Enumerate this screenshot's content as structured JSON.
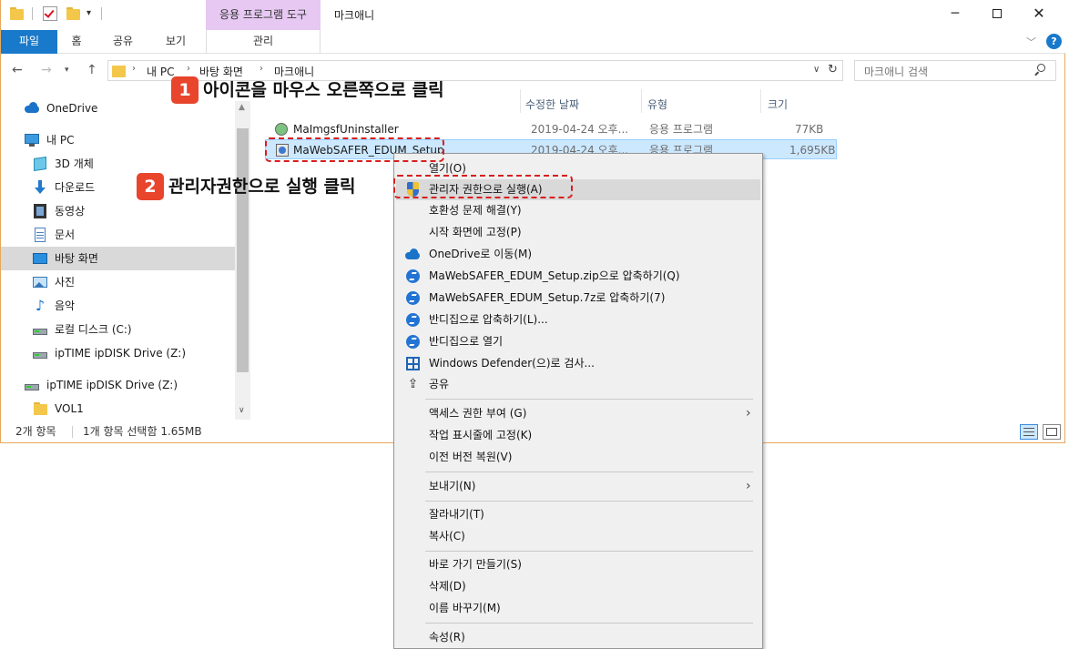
{
  "window": {
    "title": "마크애니",
    "tool_tab": "응용 프로그램 도구",
    "buttons": {
      "minimize": "─",
      "close": "✕"
    }
  },
  "ribbon": {
    "tabs": [
      "파일",
      "홈",
      "공유",
      "보기",
      "관리"
    ],
    "help": "?"
  },
  "address": {
    "crumbs": [
      "내 PC",
      "바탕 화면",
      "마크애니"
    ],
    "search_placeholder": "마크애니 검색"
  },
  "nav_pane": {
    "items": [
      {
        "label": "OneDrive",
        "icon": "onedrive-icon"
      },
      {
        "label": "내 PC",
        "icon": "pc-icon"
      },
      {
        "label": "3D 개체",
        "icon": "3d-objects-icon"
      },
      {
        "label": "다운로드",
        "icon": "download-icon"
      },
      {
        "label": "동영상",
        "icon": "video-icon"
      },
      {
        "label": "문서",
        "icon": "document-icon"
      },
      {
        "label": "바탕 화면",
        "icon": "desktop-icon",
        "selected": true
      },
      {
        "label": "사진",
        "icon": "pictures-icon"
      },
      {
        "label": "음악",
        "icon": "music-icon"
      },
      {
        "label": "로컬 디스크 (C:)",
        "icon": "local-disk-icon"
      },
      {
        "label": "ipTIME ipDISK Drive (Z:)",
        "icon": "network-drive-icon"
      },
      {
        "label": "ipTIME ipDISK Drive (Z:)",
        "icon": "network-drive-icon"
      },
      {
        "label": "VOL1",
        "icon": "folder-icon"
      }
    ]
  },
  "file_list": {
    "columns": {
      "date": "수정한 날짜",
      "type": "유형",
      "size": "크기"
    },
    "rows": [
      {
        "name": "MaImgsfUninstaller",
        "date": "2019-04-24 오후...",
        "type": "응용 프로그램",
        "size": "77KB"
      },
      {
        "name": "MaWebSAFER_EDUM_Setup",
        "date": "2019-04-24 오후...",
        "type": "응용 프로그램",
        "size": "1,695KB",
        "selected": true
      }
    ]
  },
  "status_bar": {
    "count": "2개 항목",
    "selection": "1개 항목 선택함 1.65MB"
  },
  "context_menu": {
    "items": [
      "열기(O)",
      "관리자 권한으로 실행(A)",
      "호환성 문제 해결(Y)",
      "시작 화면에 고정(P)",
      "OneDrive로 이동(M)",
      "MaWebSAFER_EDUM_Setup.zip으로 압축하기(Q)",
      "MaWebSAFER_EDUM_Setup.7z로 압축하기(7)",
      "반디집으로 압축하기(L)...",
      "반디집으로 열기",
      "Windows Defender(으)로 검사...",
      "공유",
      "액세스 권한 부여 (G)",
      "작업 표시줄에 고정(K)",
      "이전 버전 복원(V)",
      "보내기(N)",
      "잘라내기(T)",
      "복사(C)",
      "바로 가기 만들기(S)",
      "삭제(D)",
      "이름 바꾸기(M)",
      "속성(R)"
    ]
  },
  "annotations": {
    "step1_num": "1",
    "step1_text": "아이콘을 마우스 오른쪽으로 클릭",
    "step2_num": "2",
    "step2_text": "관리자권한으로 실행 클릭"
  },
  "colors": {
    "accent": "#1979ca",
    "tool_tab": "#e6c8f2",
    "selection": "#cce8ff",
    "callout": "#e8452c",
    "dash": "#d81e1e"
  }
}
